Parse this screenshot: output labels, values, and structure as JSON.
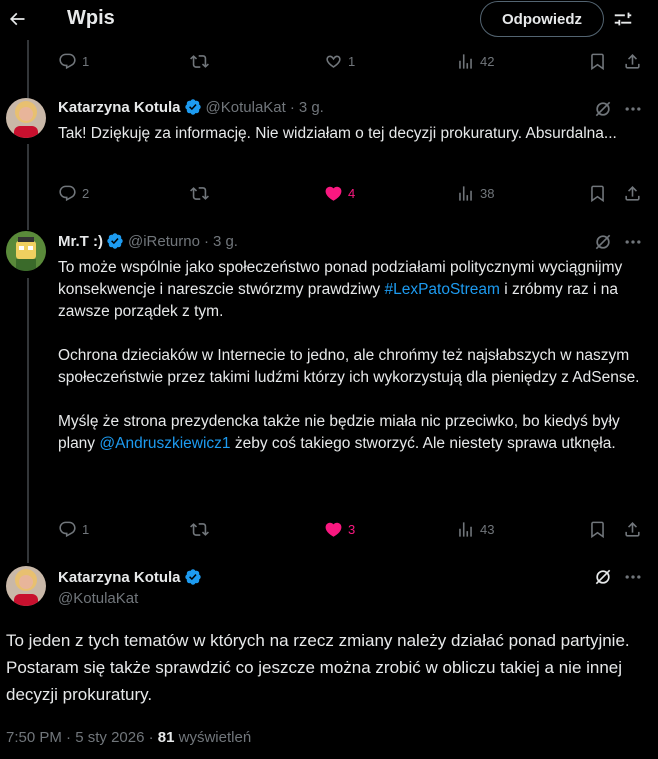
{
  "header": {
    "title": "Wpis",
    "reply_label": "Odpowiedz"
  },
  "top_actions": {
    "replies": "1",
    "retweets": "",
    "likes": "1",
    "views": "42"
  },
  "posts": [
    {
      "name": "Katarzyna Kotula",
      "handle": "@KotulaKat",
      "time": "3 g.",
      "text": "Tak! Dziękuję za informację. Nie widziałam o tej decyzji prokuratury. Absurdalna...",
      "replies": "2",
      "retweets": "",
      "likes": "4",
      "views": "38",
      "liked": true
    },
    {
      "name": "Mr.T :)",
      "handle": "@iReturno",
      "time": "3 g.",
      "text_p1_a": "To może wspólnie jako społeczeństwo ponad podziałami politycznymi wyciągnijmy konsekwencje i nareszcie stwórzmy prawdziwy ",
      "text_p1_link": "#LexPatoStream",
      "text_p1_b": " i zróbmy raz i na zawsze porządek z tym.",
      "text_p2": "Ochrona dzieciaków w Internecie to jedno, ale chrońmy też najsłabszych w naszym społeczeństwie przez takimi ludźmi którzy ich wykorzystują dla pieniędzy z AdSense.",
      "text_p3_a": "Myślę że strona prezydencka także nie będzie miała nic przeciwko, bo kiedyś były plany ",
      "text_p3_link": "@Andruszkiewicz1",
      "text_p3_b": " żeby coś takiego stworzyć. Ale niestety sprawa utknęła.",
      "replies": "1",
      "retweets": "",
      "likes": "3",
      "views": "43",
      "liked": true
    }
  ],
  "main_post": {
    "name": "Katarzyna Kotula",
    "handle": "@KotulaKat",
    "text": "To jeden z tych tematów w których na rzecz zmiany należy działać ponad partyjnie. Postaram się także sprawdzić co jeszcze można zrobić w obliczu takiej a nie innej decyzji prokuratury.",
    "time": "7:50 PM",
    "date": "5 sty 2026",
    "views_count": "81",
    "views_label": "wyświetleń"
  },
  "colors": {
    "background": "#000000",
    "text": "#e7e9ea",
    "muted": "#71767b",
    "link": "#1d9bf0",
    "like": "#f91880",
    "verified": "#1d9bf0"
  }
}
